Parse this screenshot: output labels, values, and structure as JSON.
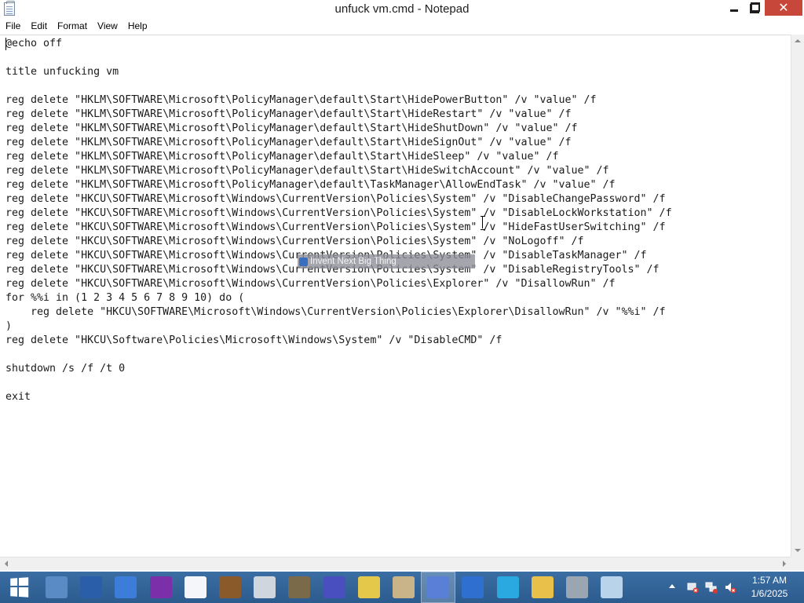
{
  "window": {
    "title": "unfuck vm.cmd - Notepad",
    "close_glyph": "✕"
  },
  "menu": {
    "items": [
      "File",
      "Edit",
      "Format",
      "View",
      "Help"
    ]
  },
  "editor": {
    "lines": [
      "@echo off",
      "",
      "title unfucking vm",
      "",
      "reg delete \"HKLM\\SOFTWARE\\Microsoft\\PolicyManager\\default\\Start\\HidePowerButton\" /v \"value\" /f",
      "reg delete \"HKLM\\SOFTWARE\\Microsoft\\PolicyManager\\default\\Start\\HideRestart\" /v \"value\" /f",
      "reg delete \"HKLM\\SOFTWARE\\Microsoft\\PolicyManager\\default\\Start\\HideShutDown\" /v \"value\" /f",
      "reg delete \"HKLM\\SOFTWARE\\Microsoft\\PolicyManager\\default\\Start\\HideSignOut\" /v \"value\" /f",
      "reg delete \"HKLM\\SOFTWARE\\Microsoft\\PolicyManager\\default\\Start\\HideSleep\" /v \"value\" /f",
      "reg delete \"HKLM\\SOFTWARE\\Microsoft\\PolicyManager\\default\\Start\\HideSwitchAccount\" /v \"value\" /f",
      "reg delete \"HKLM\\SOFTWARE\\Microsoft\\PolicyManager\\default\\TaskManager\\AllowEndTask\" /v \"value\" /f",
      "reg delete \"HKCU\\SOFTWARE\\Microsoft\\Windows\\CurrentVersion\\Policies\\System\" /v \"DisableChangePassword\" /f",
      "reg delete \"HKCU\\SOFTWARE\\Microsoft\\Windows\\CurrentVersion\\Policies\\System\" /v \"DisableLockWorkstation\" /f",
      "reg delete \"HKCU\\SOFTWARE\\Microsoft\\Windows\\CurrentVersion\\Policies\\System\" /v \"HideFastUserSwitching\" /f",
      "reg delete \"HKCU\\SOFTWARE\\Microsoft\\Windows\\CurrentVersion\\Policies\\System\" /v \"NoLogoff\" /f",
      "reg delete \"HKCU\\SOFTWARE\\Microsoft\\Windows\\CurrentVersion\\Policies\\System\" /v \"DisableTaskManager\" /f",
      "reg delete \"HKCU\\SOFTWARE\\Microsoft\\Windows\\CurrentVersion\\Policies\\System\" /v \"DisableRegistryTools\" /f",
      "reg delete \"HKCU\\SOFTWARE\\Microsoft\\Windows\\CurrentVersion\\Policies\\Explorer\" /v \"DisallowRun\" /f",
      "for %%i in (1 2 3 4 5 6 7 8 9 10) do (",
      "    reg delete \"HKCU\\SOFTWARE\\Microsoft\\Windows\\CurrentVersion\\Policies\\Explorer\\DisallowRun\" /v \"%%i\" /f",
      ")",
      "reg delete \"HKCU\\Software\\Policies\\Microsoft\\Windows\\System\" /v \"DisableCMD\" /f",
      "",
      "shutdown /s /f /t 0",
      "",
      "exit"
    ]
  },
  "overlay": {
    "text": "Invent Next Big Thing"
  },
  "taskbar": {
    "icons": [
      {
        "name": "server-manager-icon",
        "color": "#5b8bc4"
      },
      {
        "name": "powershell-icon",
        "color": "#2a5ea8"
      },
      {
        "name": "refresh-app-icon",
        "color": "#3b7dd8"
      },
      {
        "name": "yahoo-messenger-icon",
        "color": "#7b2fa8"
      },
      {
        "name": "blank-document-icon",
        "color": "#f4f6fa"
      },
      {
        "name": "minecraft-chest-icon",
        "color": "#8a5a2b"
      },
      {
        "name": "camera-app-icon",
        "color": "#d0d6de"
      },
      {
        "name": "gimp-icon",
        "color": "#7a6a4a"
      },
      {
        "name": "virus-icon",
        "color": "#4a4fc0"
      },
      {
        "name": "monitor-99-icon",
        "color": "#e3c84a"
      },
      {
        "name": "paint-palette-icon",
        "color": "#c9b48a"
      },
      {
        "name": "blue-creature-icon",
        "color": "#5a7fd6"
      },
      {
        "name": "letter-a-app-icon",
        "color": "#2f6fd0"
      },
      {
        "name": "w-app-icon",
        "color": "#2aa8e0"
      },
      {
        "name": "file-explorer-icon",
        "color": "#e8c04a"
      },
      {
        "name": "network-puzzle-icon",
        "color": "#9aa6b2"
      },
      {
        "name": "notepad-icon",
        "color": "#b9d4ea"
      }
    ],
    "active_icon": "blue-creature-icon"
  },
  "tray": {
    "icons": [
      "tray-chevron-icon",
      "network-error-icon",
      "network-status-icon",
      "volume-muted-icon"
    ]
  },
  "clock": {
    "time": "1:57 AM",
    "date": "1/6/2025"
  }
}
